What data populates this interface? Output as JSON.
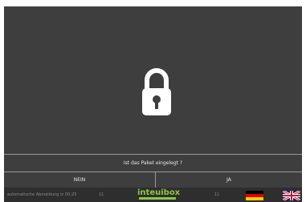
{
  "prompt": {
    "question": "Ist das Paket eingelegt ?"
  },
  "buttons": {
    "no_label": "NEIN",
    "yes_label": "JA"
  },
  "status_bar": {
    "auto_logout_text": "automatische Abmeldung in 00:25",
    "counter_left": "11",
    "counter_right": "11",
    "logo_text": "inteuibox"
  },
  "icons": {
    "center": "lock-icon",
    "languages": [
      "flag-germany-icon",
      "flag-uk-icon"
    ]
  },
  "colors": {
    "background": "#3e3e3e",
    "divider": "#9a9a9a",
    "text": "#e8e8e8",
    "logo_green": "#8ec641"
  }
}
